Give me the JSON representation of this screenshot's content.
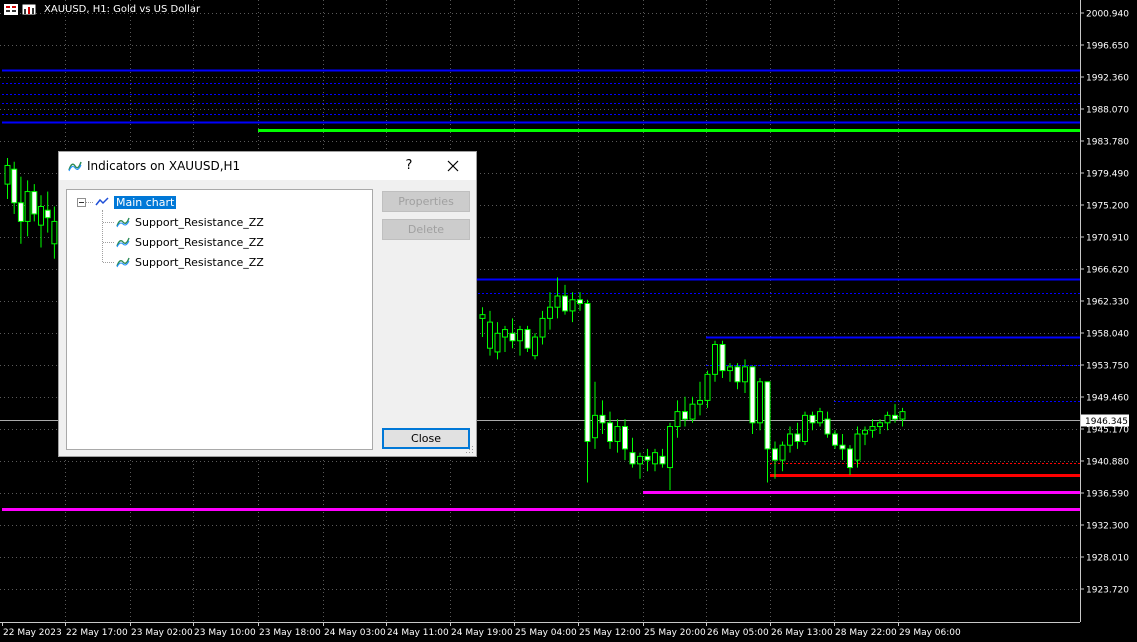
{
  "window": {
    "symbol_title": "XAUUSD, H1:  Gold vs US Dollar"
  },
  "colors": {
    "background": "#000000",
    "grid": "#5a5a5a",
    "bull_candle": "#00ff00",
    "support": "#0000ff",
    "resistance_green": "#00ff00",
    "red_line": "#ff0000",
    "magenta_line": "#ff00ff",
    "price_line": "#ffffff"
  },
  "price_axis": {
    "labels": [
      "2000.940",
      "1996.650",
      "1992.360",
      "1988.070",
      "1983.780",
      "1979.490",
      "1975.200",
      "1970.910",
      "1966.620",
      "1962.330",
      "1958.040",
      "1953.750",
      "1949.460",
      "1945.170",
      "1940.880",
      "1936.590",
      "1932.300",
      "1928.010",
      "1923.720"
    ],
    "current_price": "1946.345",
    "range": [
      1920.4,
      2002.2
    ]
  },
  "time_axis": {
    "labels": [
      "22 May 2023",
      "22 May 17:00",
      "23 May 02:00",
      "23 May 10:00",
      "23 May 18:00",
      "24 May 03:00",
      "24 May 11:00",
      "24 May 19:00",
      "25 May 04:00",
      "25 May 12:00",
      "25 May 20:00",
      "26 May 05:00",
      "26 May 13:00",
      "28 May 22:00",
      "29 May 06:00"
    ]
  },
  "levels": [
    {
      "price": 1993.3,
      "color": "blue",
      "from": "22 May 2023",
      "style": "solid"
    },
    {
      "price": 1991.6,
      "color": "blue",
      "from": "22 May 2023",
      "style": "dotted"
    },
    {
      "price": 1990.1,
      "color": "blue",
      "from": "22 May 2023",
      "style": "dotted"
    },
    {
      "price": 1988.9,
      "color": "blue",
      "from": "22 May 2023",
      "style": "dotted"
    },
    {
      "price": 1987.4,
      "color": "blue",
      "from": "22 May 2023",
      "style": "dotted"
    },
    {
      "price": 1986.3,
      "color": "blue",
      "from": "22 May 2023",
      "style": "solid"
    },
    {
      "price": 1985.2,
      "color": "green",
      "from": "23 May 18:00",
      "style": "solid"
    },
    {
      "price": 1965.3,
      "color": "blue",
      "from": "24 May 19:00",
      "style": "solid"
    },
    {
      "price": 1963.4,
      "color": "blue",
      "from": "24 May 19:00",
      "style": "dotted"
    },
    {
      "price": 1957.5,
      "color": "blue",
      "from": "26 May 05:00",
      "style": "solid"
    },
    {
      "price": 1953.8,
      "color": "blue",
      "from": "26 May 05:00",
      "style": "dotted"
    },
    {
      "price": 1948.9,
      "color": "blue",
      "from": "28 May 22:00",
      "style": "dotted"
    },
    {
      "price": 1940.6,
      "color": "red",
      "from": "26 May 13:00",
      "style": "dotted"
    },
    {
      "price": 1939.0,
      "color": "red",
      "from": "26 May 13:00",
      "style": "solid"
    },
    {
      "price": 1936.7,
      "color": "magenta",
      "from": "25 May 20:00",
      "style": "solid"
    },
    {
      "price": 1934.4,
      "color": "magenta",
      "from": "22 May 2023",
      "style": "solid"
    }
  ],
  "candles": [
    {
      "o": 1978.0,
      "h": 1981.5,
      "l": 1976.0,
      "c": 1980.5
    },
    {
      "o": 1980.0,
      "h": 1981.0,
      "l": 1974.0,
      "c": 1975.5
    },
    {
      "o": 1975.5,
      "h": 1979.0,
      "l": 1970.0,
      "c": 1973.0
    },
    {
      "o": 1973.0,
      "h": 1978.5,
      "l": 1971.0,
      "c": 1977.0
    },
    {
      "o": 1977.0,
      "h": 1978.0,
      "l": 1973.0,
      "c": 1974.0
    },
    {
      "o": 1972.5,
      "h": 1976.5,
      "l": 1969.5,
      "c": 1975.0
    },
    {
      "o": 1974.5,
      "h": 1977.0,
      "l": 1971.5,
      "c": 1973.5
    },
    {
      "o": 1970.0,
      "h": 1975.0,
      "l": 1968.0,
      "c": 1973.0
    },
    {
      "o": 1960.0,
      "h": 1961.5,
      "l": 1957.5,
      "c": 1960.5
    },
    {
      "o": 1956.0,
      "h": 1961.0,
      "l": 1955.0,
      "c": 1959.5
    },
    {
      "o": 1955.5,
      "h": 1959.5,
      "l": 1954.5,
      "c": 1958.0
    },
    {
      "o": 1957.5,
      "h": 1959.0,
      "l": 1955.5,
      "c": 1958.5
    },
    {
      "o": 1958.0,
      "h": 1960.0,
      "l": 1956.0,
      "c": 1957.0
    },
    {
      "o": 1957.0,
      "h": 1959.0,
      "l": 1955.0,
      "c": 1958.5
    },
    {
      "o": 1958.5,
      "h": 1959.0,
      "l": 1955.5,
      "c": 1956.0
    },
    {
      "o": 1955.0,
      "h": 1958.0,
      "l": 1954.5,
      "c": 1957.5
    },
    {
      "o": 1957.5,
      "h": 1961.0,
      "l": 1956.5,
      "c": 1960.0
    },
    {
      "o": 1960.0,
      "h": 1963.5,
      "l": 1958.5,
      "c": 1961.5
    },
    {
      "o": 1961.5,
      "h": 1965.5,
      "l": 1960.0,
      "c": 1963.0
    },
    {
      "o": 1963.0,
      "h": 1964.5,
      "l": 1960.5,
      "c": 1961.0
    },
    {
      "o": 1961.0,
      "h": 1963.5,
      "l": 1959.5,
      "c": 1962.5
    },
    {
      "o": 1962.5,
      "h": 1963.5,
      "l": 1961.0,
      "c": 1962.0
    },
    {
      "o": 1962.0,
      "h": 1962.5,
      "l": 1938.0,
      "c": 1943.5
    },
    {
      "o": 1944.0,
      "h": 1951.5,
      "l": 1942.5,
      "c": 1947.0
    },
    {
      "o": 1947.0,
      "h": 1949.0,
      "l": 1944.5,
      "c": 1946.0
    },
    {
      "o": 1946.0,
      "h": 1947.5,
      "l": 1942.5,
      "c": 1943.5
    },
    {
      "o": 1943.5,
      "h": 1946.5,
      "l": 1942.0,
      "c": 1945.5
    },
    {
      "o": 1945.5,
      "h": 1946.5,
      "l": 1941.0,
      "c": 1942.5
    },
    {
      "o": 1942.0,
      "h": 1944.0,
      "l": 1940.0,
      "c": 1940.5
    },
    {
      "o": 1940.5,
      "h": 1942.0,
      "l": 1938.5,
      "c": 1941.5
    },
    {
      "o": 1941.5,
      "h": 1942.5,
      "l": 1939.5,
      "c": 1941.0
    },
    {
      "o": 1940.5,
      "h": 1942.5,
      "l": 1939.5,
      "c": 1942.0
    },
    {
      "o": 1941.5,
      "h": 1942.5,
      "l": 1940.0,
      "c": 1940.5
    },
    {
      "o": 1940.0,
      "h": 1946.0,
      "l": 1937.0,
      "c": 1945.5
    },
    {
      "o": 1945.5,
      "h": 1949.0,
      "l": 1944.0,
      "c": 1947.5
    },
    {
      "o": 1947.5,
      "h": 1949.5,
      "l": 1945.5,
      "c": 1946.5
    },
    {
      "o": 1946.5,
      "h": 1949.5,
      "l": 1946.0,
      "c": 1948.5
    },
    {
      "o": 1948.5,
      "h": 1951.5,
      "l": 1947.0,
      "c": 1949.0
    },
    {
      "o": 1949.0,
      "h": 1953.0,
      "l": 1948.0,
      "c": 1952.5
    },
    {
      "o": 1952.5,
      "h": 1957.0,
      "l": 1951.5,
      "c": 1956.5
    },
    {
      "o": 1956.5,
      "h": 1957.0,
      "l": 1952.0,
      "c": 1953.0
    },
    {
      "o": 1953.0,
      "h": 1954.0,
      "l": 1951.5,
      "c": 1953.5
    },
    {
      "o": 1953.5,
      "h": 1954.0,
      "l": 1950.5,
      "c": 1951.5
    },
    {
      "o": 1951.5,
      "h": 1954.5,
      "l": 1950.0,
      "c": 1953.5
    },
    {
      "o": 1953.5,
      "h": 1953.5,
      "l": 1944.5,
      "c": 1946.0
    },
    {
      "o": 1946.0,
      "h": 1952.0,
      "l": 1945.0,
      "c": 1951.5
    },
    {
      "o": 1951.5,
      "h": 1951.5,
      "l": 1938.0,
      "c": 1942.5
    },
    {
      "o": 1942.5,
      "h": 1943.5,
      "l": 1938.5,
      "c": 1941.0
    },
    {
      "o": 1941.0,
      "h": 1943.5,
      "l": 1939.5,
      "c": 1943.0
    },
    {
      "o": 1943.0,
      "h": 1945.5,
      "l": 1942.0,
      "c": 1944.5
    },
    {
      "o": 1944.5,
      "h": 1946.0,
      "l": 1942.5,
      "c": 1943.5
    },
    {
      "o": 1943.5,
      "h": 1947.5,
      "l": 1943.0,
      "c": 1947.0
    },
    {
      "o": 1947.0,
      "h": 1947.5,
      "l": 1945.0,
      "c": 1946.0
    },
    {
      "o": 1946.0,
      "h": 1948.0,
      "l": 1945.5,
      "c": 1947.5
    },
    {
      "o": 1946.5,
      "h": 1947.5,
      "l": 1944.0,
      "c": 1944.5
    },
    {
      "o": 1944.5,
      "h": 1945.0,
      "l": 1942.5,
      "c": 1943.0
    },
    {
      "o": 1943.0,
      "h": 1944.5,
      "l": 1941.0,
      "c": 1942.5
    },
    {
      "o": 1942.5,
      "h": 1943.0,
      "l": 1939.0,
      "c": 1940.0
    },
    {
      "o": 1941.0,
      "h": 1945.5,
      "l": 1940.0,
      "c": 1944.5
    },
    {
      "o": 1944.5,
      "h": 1945.5,
      "l": 1943.0,
      "c": 1945.0
    },
    {
      "o": 1945.0,
      "h": 1946.5,
      "l": 1944.0,
      "c": 1945.5
    },
    {
      "o": 1945.5,
      "h": 1946.5,
      "l": 1944.5,
      "c": 1946.0
    },
    {
      "o": 1946.0,
      "h": 1947.5,
      "l": 1945.0,
      "c": 1947.0
    },
    {
      "o": 1947.0,
      "h": 1948.5,
      "l": 1946.0,
      "c": 1946.5
    },
    {
      "o": 1946.5,
      "h": 1948.0,
      "l": 1945.5,
      "c": 1947.5
    }
  ],
  "dialog": {
    "title": "Indicators on XAUUSD,H1",
    "help_label": "?",
    "tree": {
      "root_label": "Main chart",
      "items": [
        "Support_Resistance_ZZ",
        "Support_Resistance_ZZ",
        "Support_Resistance_ZZ"
      ]
    },
    "buttons": {
      "properties": "Properties",
      "delete": "Delete",
      "close": "Close"
    }
  }
}
